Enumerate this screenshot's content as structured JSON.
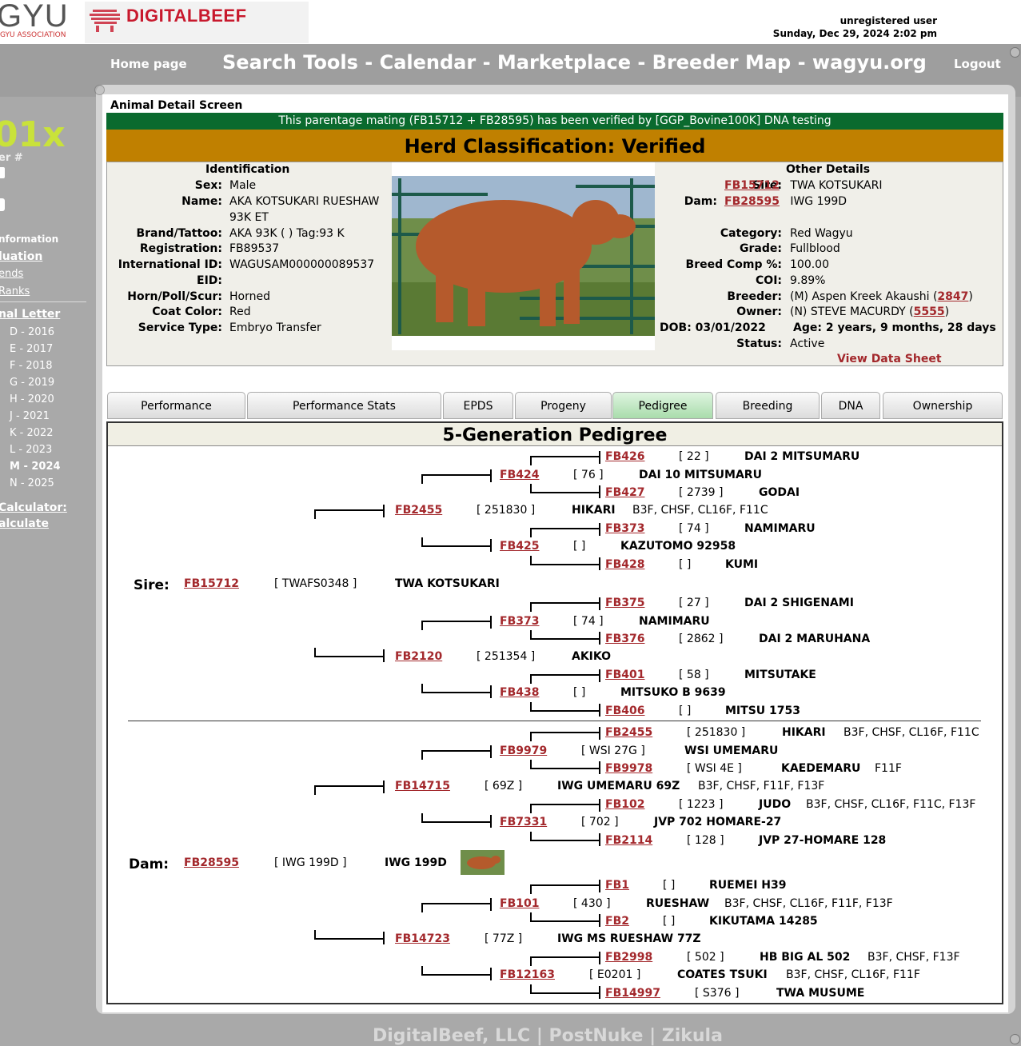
{
  "header": {
    "logo_left_text": "GYU",
    "logo_left_sub": "GYU ASSOCIATION",
    "logo_brand": "DIGITALBEEF",
    "user": "unregistered user",
    "datetime": "Sunday, Dec 29, 2024 2:02 pm"
  },
  "nav": {
    "home": "Home page",
    "main": "Search Tools - Calendar - Marketplace - Breeder Map - wagyu.org",
    "logout": "Logout"
  },
  "sidebar": {
    "big": "01x",
    "er": "er #",
    "information": "nformation",
    "evaluation": "luation",
    "trends": "ends",
    "ranks": "Ranks",
    "letter_head": "nal Letter",
    "years": [
      "D  - 2016",
      "E  - 2017",
      "F  - 2018",
      "G  - 2019",
      "H  - 2020",
      "J  - 2021",
      "K  - 2022",
      "L  - 2023",
      "M  - 2024",
      "N  - 2025"
    ],
    "calc_head": "Calculator:",
    "calc": "alculate"
  },
  "page": {
    "title": "Animal Detail Screen",
    "verified_msg": "This parentage mating (FB15712 + FB28595) has been verified by [GGP_Bovine100K] DNA testing",
    "herd": "Herd Classification: Verified"
  },
  "identification": {
    "heading": "Identification",
    "rows": [
      {
        "label": "Sex:",
        "value": "Male"
      },
      {
        "label": "Name:",
        "value": "AKA KOTSUKARI RUESHAW"
      },
      {
        "label": "",
        "value": "93K ET"
      },
      {
        "label": "Brand/Tattoo:",
        "value": "AKA 93K ( )          Tag:93 K"
      },
      {
        "label": "Registration:",
        "value": "FB89537"
      },
      {
        "label": "International ID:",
        "value": "WAGUSAM000000089537"
      },
      {
        "label": "EID:",
        "value": ""
      },
      {
        "label": "Horn/Poll/Scur:",
        "value": "Horned"
      },
      {
        "label": "Coat Color:",
        "value": "Red"
      },
      {
        "label": "Service Type:",
        "value": "Embryo Transfer"
      }
    ]
  },
  "other": {
    "heading": "Other Details",
    "sire_label": "Sire:",
    "sire_id": "FB15712",
    "sire_name": "TWA KOTSUKARI",
    "dam_label": "Dam:",
    "dam_id": "FB28595",
    "dam_name": "IWG 199D",
    "rows": [
      {
        "label": "Category:",
        "value": "Red Wagyu"
      },
      {
        "label": "Grade:",
        "value": "Fullblood"
      },
      {
        "label": "Breed Comp %:",
        "value": "100.00"
      },
      {
        "label": "COI:",
        "value": "9.89%"
      }
    ],
    "breeder_label": "Breeder:",
    "breeder_pre": "(M) Aspen Kreek Akaushi (",
    "breeder_id": "2847",
    "breeder_post": ")",
    "owner_label": "Owner:",
    "owner_pre": "(N) STEVE MACURDY (",
    "owner_id": "5555",
    "owner_post": ")",
    "dob": "DOB: 03/01/2022",
    "age": "Age: 2 years, 9 months, 28 days",
    "status_label": "Status:",
    "status": "Active",
    "datasheet": "View Data Sheet"
  },
  "tabs": [
    "Performance",
    "Performance Stats",
    "EPDS",
    "Progeny",
    "Pedigree",
    "Breeding",
    "DNA",
    "Ownership"
  ],
  "pedigree": {
    "title": "5-Generation Pedigree",
    "sire_label": "Sire:",
    "dam_label": "Dam:",
    "sire": {
      "id": "FB15712",
      "tag": "[ TWAFS0348 ]",
      "name": "TWA KOTSUKARI",
      "genetic": ""
    },
    "dam": {
      "id": "FB28595",
      "tag": "[ IWG 199D ]",
      "name": "IWG 199D",
      "genetic": ""
    },
    "rows": [
      {
        "id": "FB426",
        "tag": "[ 22 ]",
        "name": "DAI 2 MITSUMARU",
        "genetic": ""
      },
      {
        "id": "FB424",
        "tag": "[ 76 ]",
        "name": "DAI 10 MITSUMARU",
        "genetic": ""
      },
      {
        "id": "FB427",
        "tag": "[ 2739 ]",
        "name": "GODAI",
        "genetic": ""
      },
      {
        "id": "FB2455",
        "tag": "[ 251830 ]",
        "name": "HIKARI",
        "genetic": "B3F, CHSF, CL16F, F11C"
      },
      {
        "id": "FB373",
        "tag": "[ 74 ]",
        "name": "NAMIMARU",
        "genetic": ""
      },
      {
        "id": "FB425",
        "tag": "[ ]",
        "name": "KAZUTOMO 92958",
        "genetic": ""
      },
      {
        "id": "FB428",
        "tag": "[ ]",
        "name": "KUMI",
        "genetic": ""
      },
      {
        "id": "FB375",
        "tag": "[ 27 ]",
        "name": "DAI 2 SHIGENAMI",
        "genetic": ""
      },
      {
        "id": "FB373",
        "tag": "[ 74 ]",
        "name": "NAMIMARU",
        "genetic": ""
      },
      {
        "id": "FB376",
        "tag": "[ 2862 ]",
        "name": "DAI 2 MARUHANA",
        "genetic": ""
      },
      {
        "id": "FB2120",
        "tag": "[ 251354 ]",
        "name": "AKIKO",
        "genetic": ""
      },
      {
        "id": "FB401",
        "tag": "[ 58 ]",
        "name": "MITSUTAKE",
        "genetic": ""
      },
      {
        "id": "FB438",
        "tag": "[ ]",
        "name": "MITSUKO B 9639",
        "genetic": ""
      },
      {
        "id": "FB406",
        "tag": "[ ]",
        "name": "MITSU 1753",
        "genetic": ""
      },
      {
        "id": "FB2455",
        "tag": "[ 251830 ]",
        "name": "HIKARI",
        "genetic": "B3F, CHSF, CL16F, F11C"
      },
      {
        "id": "FB9979",
        "tag": "[ WSI 27G ]",
        "name": "WSI UMEMARU",
        "genetic": ""
      },
      {
        "id": "FB9978",
        "tag": "[ WSI 4E ]",
        "name": "KAEDEMARU",
        "genetic": "F11F"
      },
      {
        "id": "FB14715",
        "tag": "[ 69Z ]",
        "name": "IWG UMEMARU 69Z",
        "genetic": "B3F, CHSF, F11F, F13F"
      },
      {
        "id": "FB102",
        "tag": "[ 1223 ]",
        "name": "JUDO",
        "genetic": "B3F, CHSF, CL16F, F11C, F13F"
      },
      {
        "id": "FB7331",
        "tag": "[ 702 ]",
        "name": "JVP 702 HOMARE-27",
        "genetic": ""
      },
      {
        "id": "FB2114",
        "tag": "[ 128 ]",
        "name": "JVP 27-HOMARE 128",
        "genetic": ""
      },
      {
        "id": "FB1",
        "tag": "[ ]",
        "name": "RUEMEI H39",
        "genetic": ""
      },
      {
        "id": "FB101",
        "tag": "[ 430 ]",
        "name": "RUESHAW",
        "genetic": "B3F, CHSF, CL16F, F11F, F13F"
      },
      {
        "id": "FB2",
        "tag": "[ ]",
        "name": "KIKUTAMA 14285",
        "genetic": ""
      },
      {
        "id": "FB14723",
        "tag": "[ 77Z ]",
        "name": "IWG MS RUESHAW 77Z",
        "genetic": ""
      },
      {
        "id": "FB2998",
        "tag": "[ 502 ]",
        "name": "HB BIG AL 502",
        "genetic": "B3F, CHSF, F13F"
      },
      {
        "id": "FB12163",
        "tag": "[ E0201 ]",
        "name": "COATES TSUKI",
        "genetic": "B3F, CHSF, CL16F, F11F"
      },
      {
        "id": "FB14997",
        "tag": "[ S376 ]",
        "name": "TWA MUSUME",
        "genetic": ""
      }
    ]
  },
  "footer": "DigitalBeef, LLC | PostNuke | Zikula"
}
